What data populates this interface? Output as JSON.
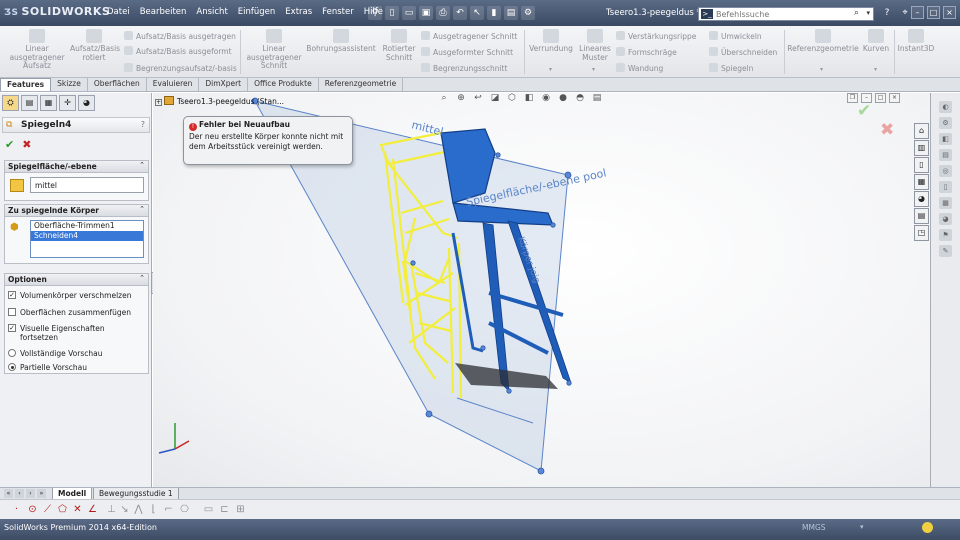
{
  "app": {
    "logo": "SOLIDWORKS",
    "menu": [
      "Datei",
      "Bearbeiten",
      "Ansicht",
      "Einfügen",
      "Extras",
      "Fenster",
      "Hilfe"
    ],
    "document_title": "Tseero1.3-peegeldus *",
    "search_placeholder": "Befehlssuche"
  },
  "ribbon": {
    "big_buttons": [
      {
        "label": "Linear ausgetragener Aufsatz",
        "icon": "extrude-boss-icon"
      },
      {
        "label": "Aufsatz/Basis rotiert",
        "icon": "revolve-boss-icon"
      },
      {
        "label": "Linear ausgetragener Schnitt",
        "icon": "extrude-cut-icon"
      },
      {
        "label": "Bohrungsassistent",
        "icon": "hole-wizard-icon"
      },
      {
        "label": "Rotierter Schnitt",
        "icon": "revolve-cut-icon"
      },
      {
        "label": "Verrundung",
        "icon": "fillet-icon"
      },
      {
        "label": "Lineares Muster",
        "icon": "linear-pattern-icon"
      },
      {
        "label": "Referenzgeometrie",
        "icon": "reference-geometry-icon"
      },
      {
        "label": "Kurven",
        "icon": "curves-icon"
      },
      {
        "label": "Instant3D",
        "icon": "instant3d-icon"
      }
    ],
    "small_buttons": [
      {
        "label": "Aufsatz/Basis ausgetragen",
        "icon": "swept-boss-icon"
      },
      {
        "label": "Aufsatz/Basis ausgeformt",
        "icon": "lofted-boss-icon"
      },
      {
        "label": "Begrenzungsaufsatz/-basis",
        "icon": "boundary-boss-icon"
      },
      {
        "label": "Ausgetragener Schnitt",
        "icon": "swept-cut-icon"
      },
      {
        "label": "Ausgeformter Schnitt",
        "icon": "lofted-cut-icon"
      },
      {
        "label": "Begrenzungsschnitt",
        "icon": "boundary-cut-icon"
      },
      {
        "label": "Verstärkungsrippe",
        "icon": "rib-icon"
      },
      {
        "label": "Formschräge",
        "icon": "draft-icon"
      },
      {
        "label": "Wandung",
        "icon": "shell-icon"
      },
      {
        "label": "Umwickeln",
        "icon": "wrap-icon"
      },
      {
        "label": "Überschneiden",
        "icon": "intersect-icon"
      },
      {
        "label": "Spiegeln",
        "icon": "mirror-icon"
      }
    ]
  },
  "tabs": [
    "Features",
    "Skizze",
    "Oberflächen",
    "Evaluieren",
    "DimXpert",
    "Office Produkte",
    "Referenzgeometrie"
  ],
  "property_manager": {
    "title": "Spiegeln4",
    "help": "?",
    "ok": "✔",
    "cancel": "✖",
    "mirror_plane": {
      "header": "Spiegelfläche/-ebene",
      "value": "mittel"
    },
    "bodies": {
      "header": "Zu spiegelnde Körper",
      "items": [
        "Oberfläche-Trimmen1",
        "Schneiden4"
      ],
      "selected": "Schneiden4"
    },
    "options": {
      "header": "Optionen",
      "items": [
        {
          "label": "Volumenkörper verschmelzen",
          "type": "checkbox",
          "checked": true
        },
        {
          "label": "Oberflächen zusammenfügen",
          "type": "checkbox",
          "checked": false
        },
        {
          "label": "Visuelle Eigenschaften fortsetzen",
          "type": "checkbox",
          "checked": true
        },
        {
          "label": "Vollständige Vorschau",
          "type": "radio",
          "checked": false
        },
        {
          "label": "Partielle Vorschau",
          "type": "radio",
          "checked": true
        }
      ]
    }
  },
  "viewport": {
    "tree_label": "Tseero1.3-peegeldus  (Stan...",
    "error_callout": {
      "title": "Fehler bei Neuaufbau",
      "message": "Der neu erstellte Körper konnte nicht mit dem Arbeitsstück vereinigt werden."
    },
    "plane_labels": [
      "mittel",
      "Spiegelfläche/-ebene pool",
      "Körper joig"
    ],
    "colors": {
      "body": "#2a6ccc",
      "preview": "#f2ee3a",
      "plane": "#9fb6d9"
    }
  },
  "bottom_tabs": [
    "Modell",
    "Bewegungsstudie 1"
  ],
  "status": {
    "product": "SolidWorks Premium 2014 x64-Edition",
    "units": "MMGS"
  }
}
